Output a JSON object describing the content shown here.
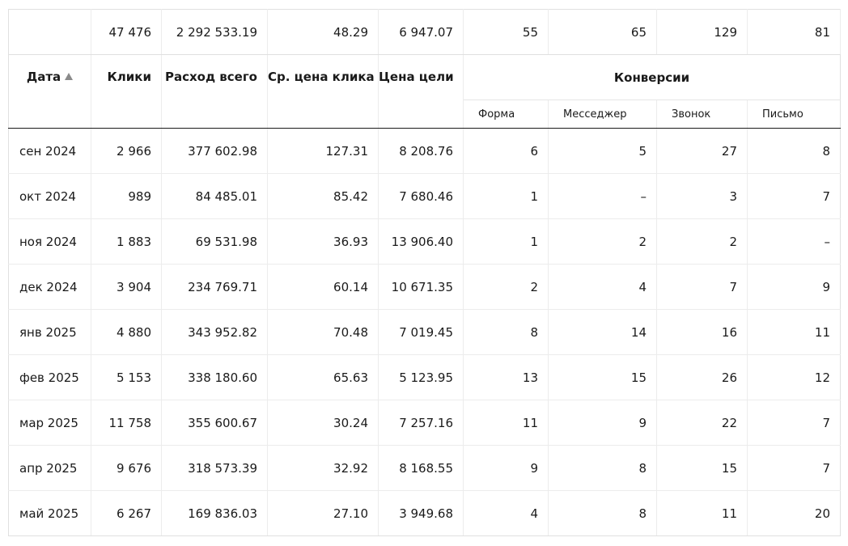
{
  "totals": {
    "clicks": "47 476",
    "spend": "2 292 533.19",
    "avg_cpc": "48.29",
    "goal_cost": "6 947.07",
    "form": "55",
    "messenger": "65",
    "call": "129",
    "email": "81"
  },
  "headers": {
    "date": "Дата",
    "clicks": "Клики",
    "spend": "Расход всего",
    "avg_cpc": "Ср. цена клика",
    "goal_cost": "Цена цели",
    "conversions": "Конверсии",
    "form": "Форма",
    "messenger": "Месседжер",
    "call": "Звонок",
    "email": "Письмо"
  },
  "rows": [
    {
      "date": "сен 2024",
      "clicks": "2 966",
      "spend": "377 602.98",
      "avg_cpc": "127.31",
      "goal_cost": "8 208.76",
      "form": "6",
      "messenger": "5",
      "call": "27",
      "email": "8"
    },
    {
      "date": "окт 2024",
      "clicks": "989",
      "spend": "84 485.01",
      "avg_cpc": "85.42",
      "goal_cost": "7 680.46",
      "form": "1",
      "messenger": "–",
      "call": "3",
      "email": "7"
    },
    {
      "date": "ноя 2024",
      "clicks": "1 883",
      "spend": "69 531.98",
      "avg_cpc": "36.93",
      "goal_cost": "13 906.40",
      "form": "1",
      "messenger": "2",
      "call": "2",
      "email": "–"
    },
    {
      "date": "дек 2024",
      "clicks": "3 904",
      "spend": "234 769.71",
      "avg_cpc": "60.14",
      "goal_cost": "10 671.35",
      "form": "2",
      "messenger": "4",
      "call": "7",
      "email": "9"
    },
    {
      "date": "янв 2025",
      "clicks": "4 880",
      "spend": "343 952.82",
      "avg_cpc": "70.48",
      "goal_cost": "7 019.45",
      "form": "8",
      "messenger": "14",
      "call": "16",
      "email": "11"
    },
    {
      "date": "фев 2025",
      "clicks": "5 153",
      "spend": "338 180.60",
      "avg_cpc": "65.63",
      "goal_cost": "5 123.95",
      "form": "13",
      "messenger": "15",
      "call": "26",
      "email": "12"
    },
    {
      "date": "мар 2025",
      "clicks": "11 758",
      "spend": "355 600.67",
      "avg_cpc": "30.24",
      "goal_cost": "7 257.16",
      "form": "11",
      "messenger": "9",
      "call": "22",
      "email": "7"
    },
    {
      "date": "апр 2025",
      "clicks": "9 676",
      "spend": "318 573.39",
      "avg_cpc": "32.92",
      "goal_cost": "8 168.55",
      "form": "9",
      "messenger": "8",
      "call": "15",
      "email": "7"
    },
    {
      "date": "май 2025",
      "clicks": "6 267",
      "spend": "169 836.03",
      "avg_cpc": "27.10",
      "goal_cost": "3 949.68",
      "form": "4",
      "messenger": "8",
      "call": "11",
      "email": "20"
    }
  ],
  "colors": {
    "text": "#1a1a1a",
    "grid": "#ececec",
    "header_rule": "#1a1a1a",
    "sort_arrow": "#8a8a8a"
  },
  "icons": {
    "sort": "sort-ascending-icon"
  }
}
